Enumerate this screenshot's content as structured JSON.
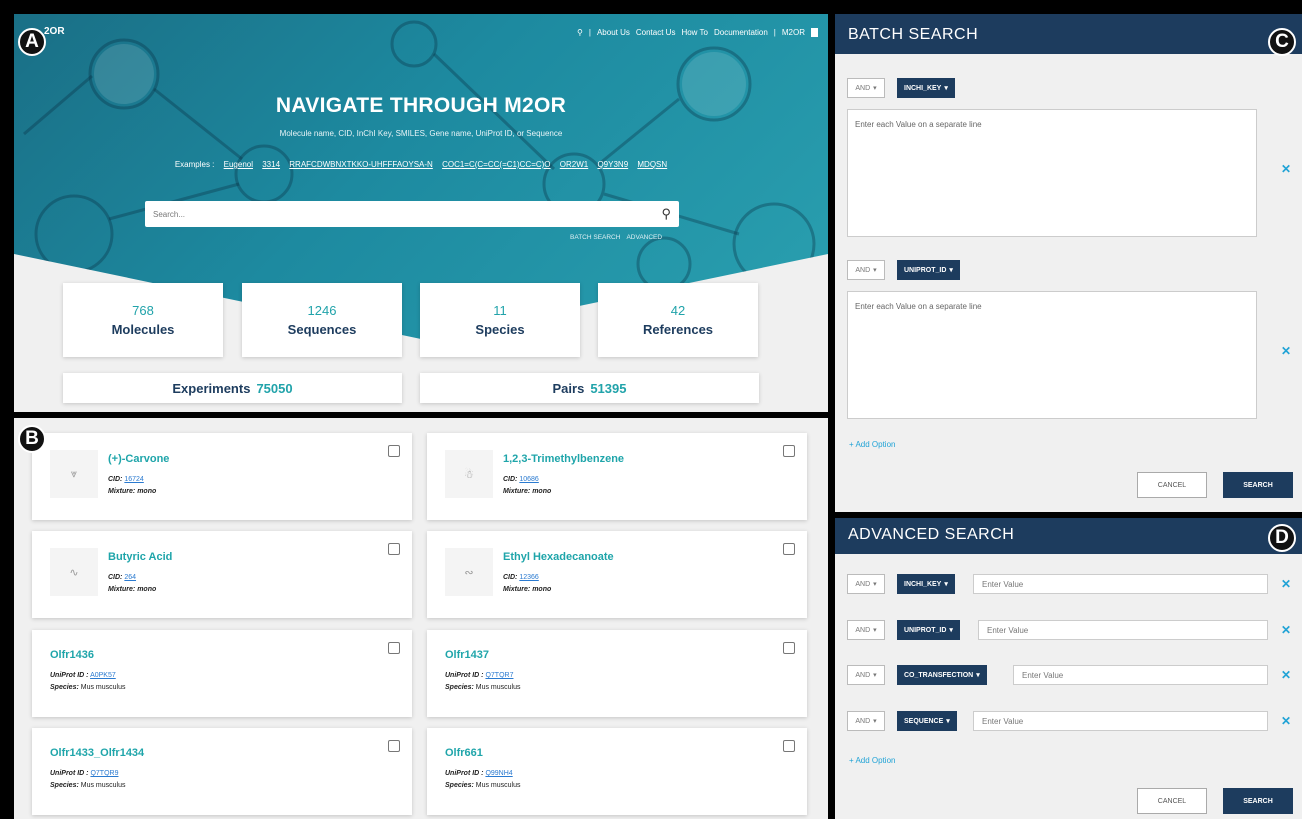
{
  "badges": {
    "a": "A",
    "b": "B",
    "c": "C",
    "d": "D"
  },
  "panel_a": {
    "logo": "2OR",
    "nav": [
      "About Us",
      "Contact Us",
      "How To",
      "Documentation"
    ],
    "nav_sep": "|",
    "nav_product": "M2OR",
    "title": "NAVIGATE THROUGH M2OR",
    "subtitle": "Molecule name, CID, InChI Key, SMILES, Gene name, UniProt ID, or Sequence",
    "examples_label": "Examples :",
    "examples": [
      "Eugenol",
      "3314",
      "RRAFCDWBNXTKKO-UHFFFAOYSA-N",
      "COC1=C(C=CC(=C1)CC=C)O",
      "OR2W1",
      "Q9Y3N9",
      "MDQSN"
    ],
    "search_placeholder": "Search...",
    "search_links": [
      "BATCH SEARCH",
      "ADVANCED"
    ],
    "stats": [
      {
        "num": "768",
        "label": "Molecules"
      },
      {
        "num": "1246",
        "label": "Sequences"
      },
      {
        "num": "11",
        "label": "Species"
      },
      {
        "num": "42",
        "label": "References"
      }
    ],
    "experiments": {
      "label": "Experiments",
      "value": "75050"
    },
    "pairs": {
      "label": "Pairs",
      "value": "51395"
    }
  },
  "panel_b": {
    "cards": [
      {
        "name": "(+)-Carvone",
        "k1": "CID:",
        "v1": "16724",
        "k2": "Mixture:",
        "v2": "mono"
      },
      {
        "name": "1,2,3-Trimethylbenzene",
        "k1": "CID:",
        "v1": "10686",
        "k2": "Mixture:",
        "v2": "mono"
      },
      {
        "name": "Butyric Acid",
        "k1": "CID:",
        "v1": "264",
        "k2": "Mixture:",
        "v2": "mono"
      },
      {
        "name": "Ethyl Hexadecanoate",
        "k1": "CID:",
        "v1": "12366",
        "k2": "Mixture:",
        "v2": "mono"
      },
      {
        "name": "Olfr1436",
        "k1": "UniProt ID :",
        "v1": "A0PK57",
        "k2": "Species:",
        "v2": "Mus musculus"
      },
      {
        "name": "Olfr1437",
        "k1": "UniProt ID :",
        "v1": "Q7TQR7",
        "k2": "Species:",
        "v2": "Mus musculus"
      },
      {
        "name": "Olfr1433_Olfr1434",
        "k1": "UniProt ID :",
        "v1": "Q7TQR9",
        "k2": "Species:",
        "v2": "Mus musculus"
      },
      {
        "name": "Olfr661",
        "k1": "UniProt ID :",
        "v1": "Q99NH4",
        "k2": "Species:",
        "v2": "Mus musculus"
      }
    ]
  },
  "panel_c": {
    "title": "BATCH SEARCH",
    "rows": [
      {
        "op": "AND",
        "key": "INCHI_KEY",
        "placeholder": "Enter each Value on a separate line"
      },
      {
        "op": "AND",
        "key": "UNIPROT_ID",
        "placeholder": "Enter each Value on a separate line"
      }
    ],
    "add_option": "Add Option",
    "cancel": "CANCEL",
    "search": "SEARCH"
  },
  "panel_d": {
    "title": "ADVANCED SEARCH",
    "rows": [
      {
        "op": "AND",
        "key": "INCHI_KEY",
        "placeholder": "Enter Value"
      },
      {
        "op": "AND",
        "key": "UNIPROT_ID",
        "placeholder": "Enter Value"
      },
      {
        "op": "AND",
        "key": "CO_TRANSFECTION",
        "placeholder": "Enter Value"
      },
      {
        "op": "AND",
        "key": "SEQUENCE",
        "placeholder": "Enter Value"
      }
    ],
    "add_option": "Add Option",
    "cancel": "CANCEL",
    "search": "SEARCH"
  },
  "colors": {
    "navy": "#1d3c5e",
    "teal": "#21a3aa",
    "link": "#21a3d6"
  }
}
